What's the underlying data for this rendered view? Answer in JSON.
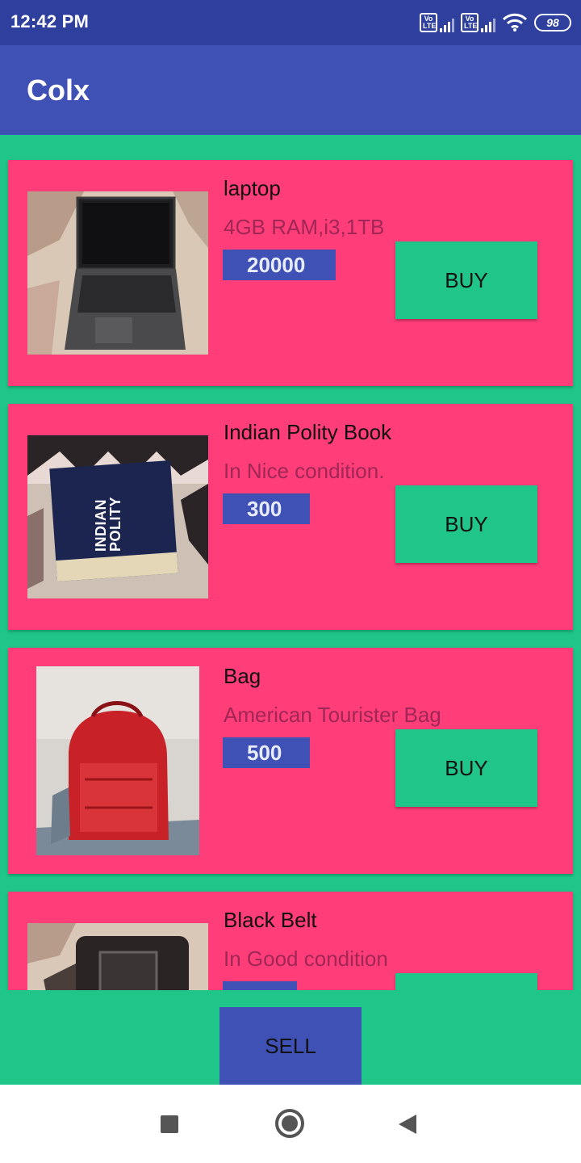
{
  "status_bar": {
    "time": "12:42 PM",
    "volte1": "Vo LTE",
    "volte2": "Vo LTE",
    "battery": "98"
  },
  "app_bar": {
    "title": "Colx"
  },
  "listings": [
    {
      "title": "laptop",
      "description": "4GB RAM,i3,1TB",
      "price": "20000",
      "buy_label": "BUY",
      "image": "laptop-photo"
    },
    {
      "title": "Indian Polity Book",
      "description": "In Nice condition.",
      "price": "300",
      "buy_label": "BUY",
      "image": "book-photo",
      "image_text": "INDIAN POLITY"
    },
    {
      "title": "Bag",
      "description": "American Tourister Bag",
      "price": "500",
      "buy_label": "BUY",
      "image": "backpack-photo"
    },
    {
      "title": "Black Belt",
      "description": "In Good condition",
      "price": "",
      "buy_label": "",
      "image": "belt-photo"
    }
  ],
  "bottom": {
    "sell_label": "SELL"
  },
  "nav": {
    "recents": "square-icon",
    "home": "circle-icon",
    "back": "triangle-icon"
  },
  "colors": {
    "primary": "#3f51b5",
    "primary_dark": "#2e3f9e",
    "accent": "#20c589",
    "card": "#ff3d79"
  }
}
